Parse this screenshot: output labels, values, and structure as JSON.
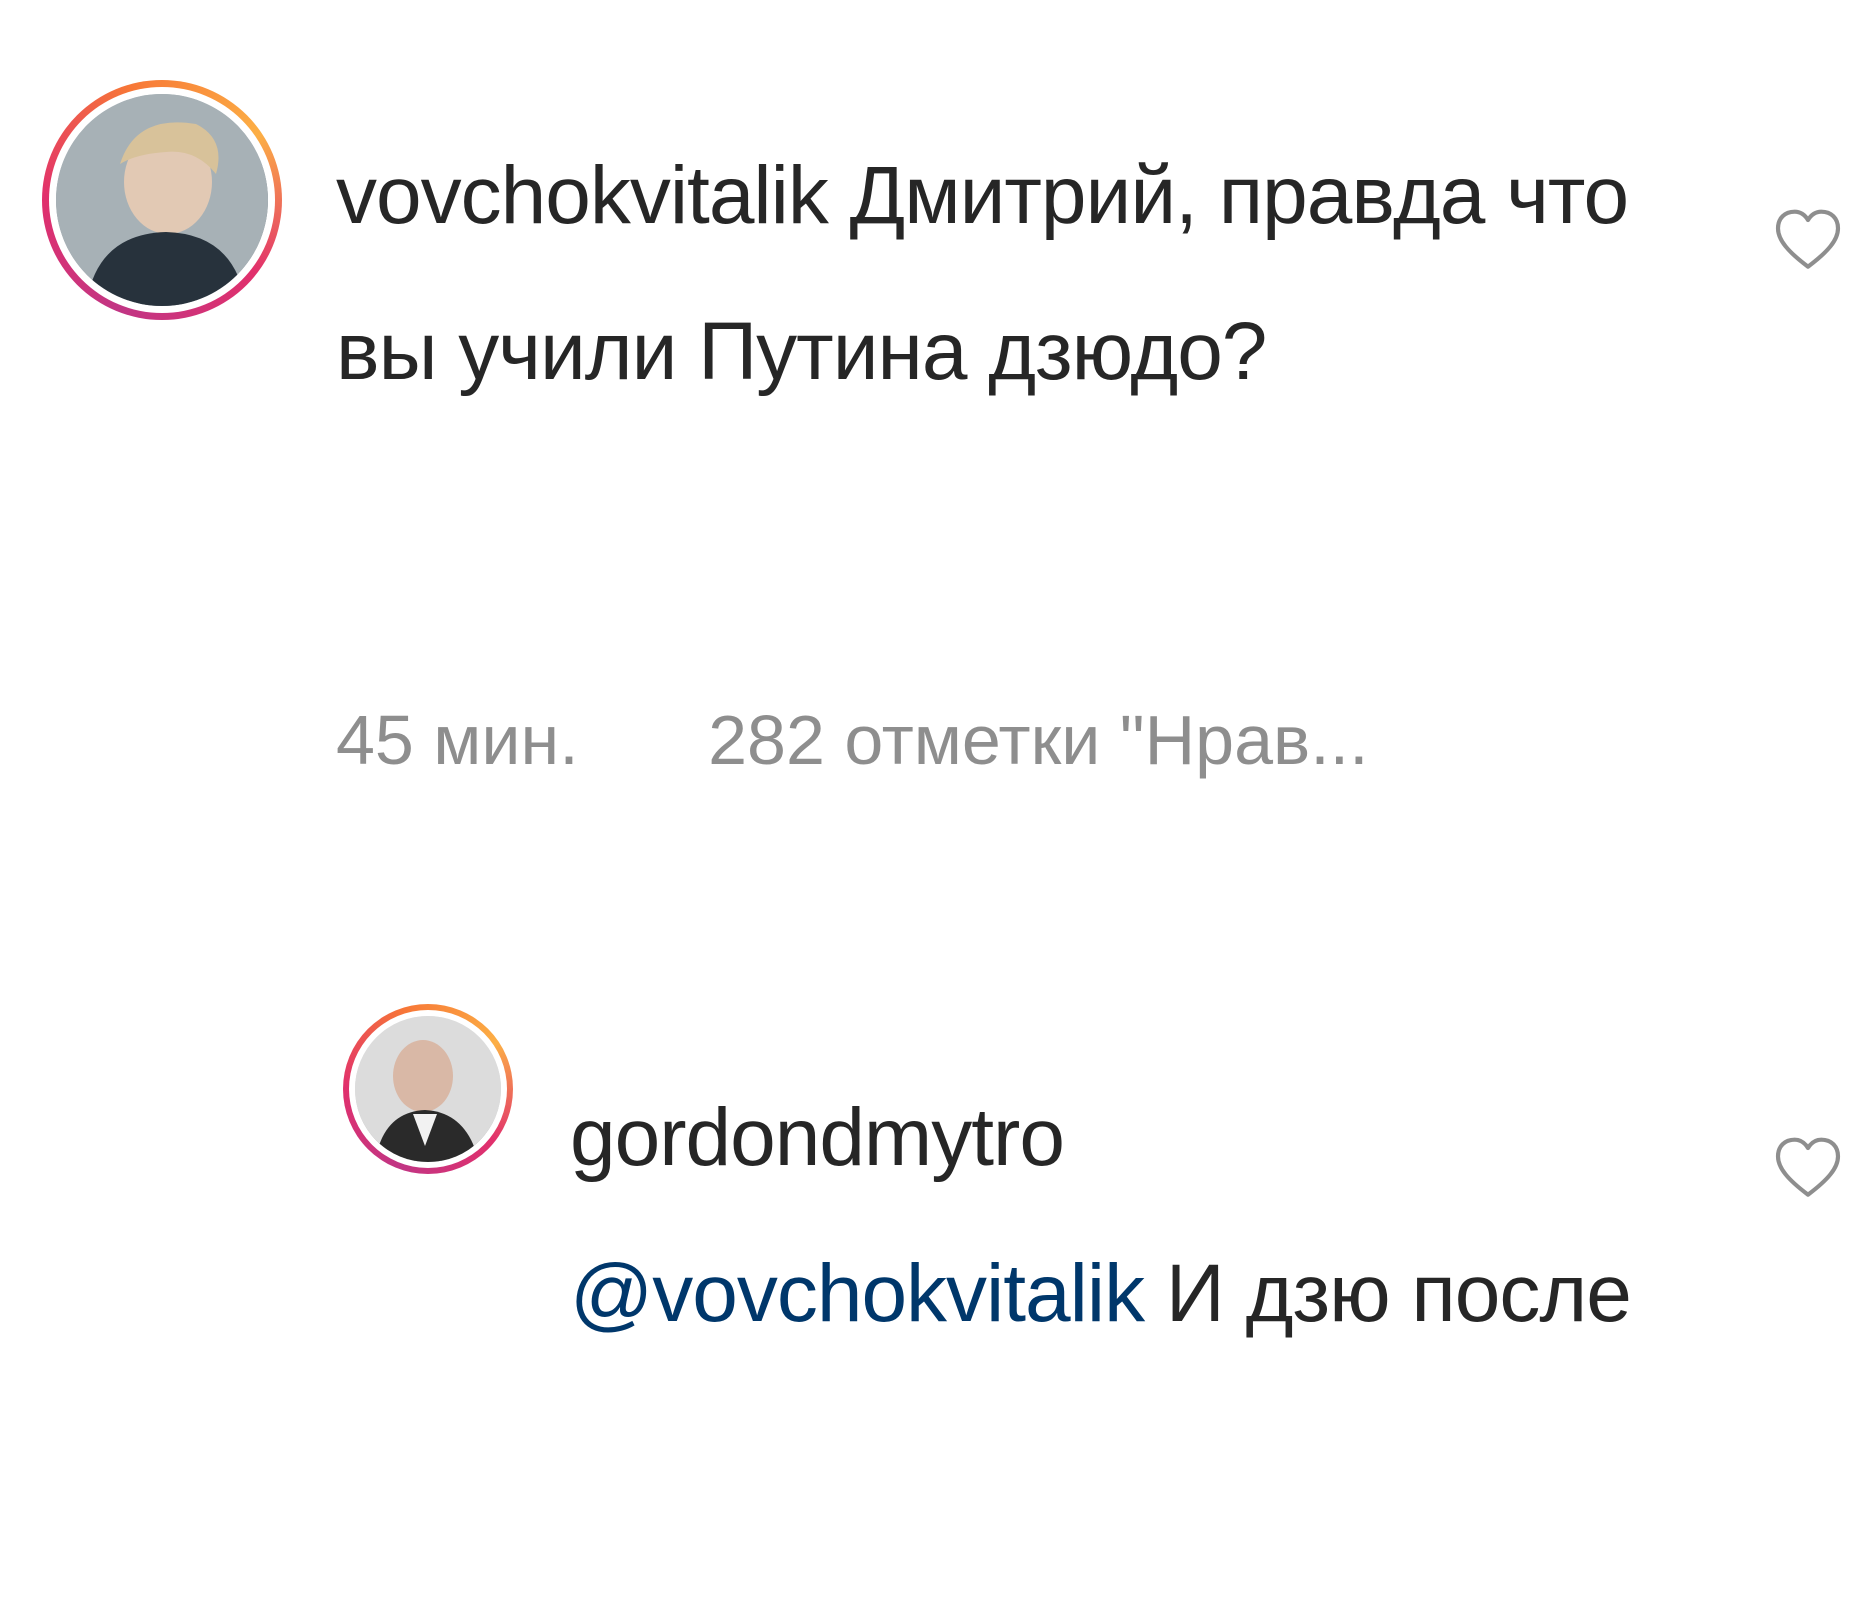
{
  "comments": [
    {
      "username": "vovchokvitalik",
      "text": "Дмитрий, правда что вы учили Путина дзюдо?",
      "time": "45 мин.",
      "likes": "282 отметки \"Нрав..."
    },
    {
      "username": "gordondmytro",
      "mention": "@vovchokvitalik",
      "text": "И дзю после"
    }
  ],
  "icons": {
    "like": "heart-outline-icon"
  },
  "colors": {
    "text": "#262626",
    "meta": "#8e8e8e",
    "mention": "#00376b"
  }
}
